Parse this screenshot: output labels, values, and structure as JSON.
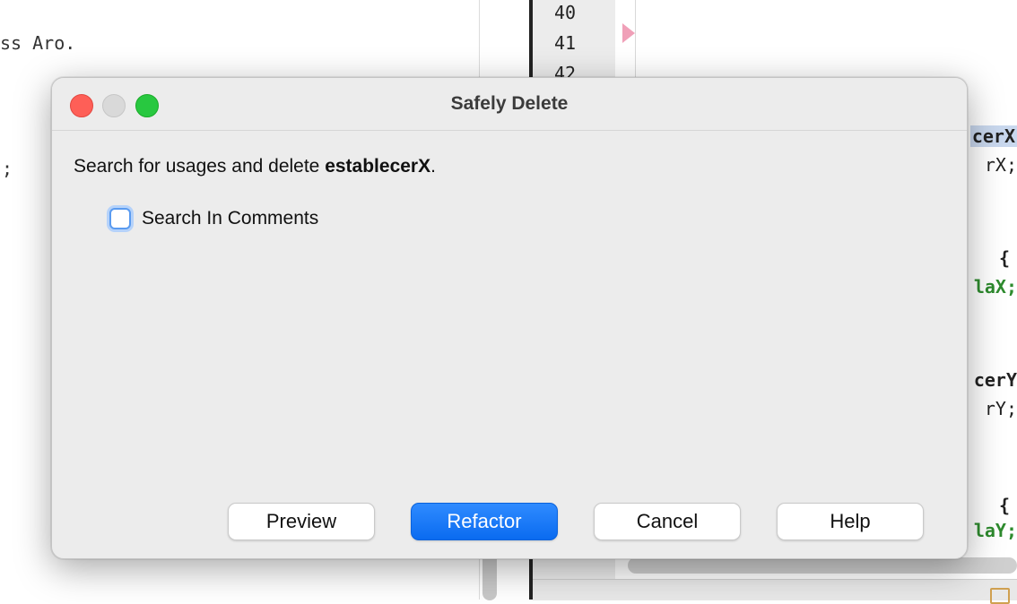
{
  "background": {
    "left_code": [
      "ss Aro.",
      ";"
    ],
    "line_numbers": [
      "40",
      "41",
      "42"
    ],
    "right_code": [
      "cerX",
      "rX;",
      "{",
      "laX;",
      "cerY",
      "rY;",
      "{",
      "laY;"
    ]
  },
  "dialog": {
    "title": "Safely Delete",
    "message_prefix": "Search for usages and delete ",
    "message_target": "establecerX",
    "message_suffix": ".",
    "checkbox": {
      "label": "Search In Comments",
      "checked": false
    },
    "buttons": {
      "preview": "Preview",
      "refactor": "Refactor",
      "cancel": "Cancel",
      "help": "Help"
    }
  },
  "colors": {
    "close": "#fe5f57",
    "minimize": "#d9d9d9",
    "maximize": "#28c840",
    "primary_button": "#0a6bf0",
    "code_green": "#2e8b2e"
  }
}
